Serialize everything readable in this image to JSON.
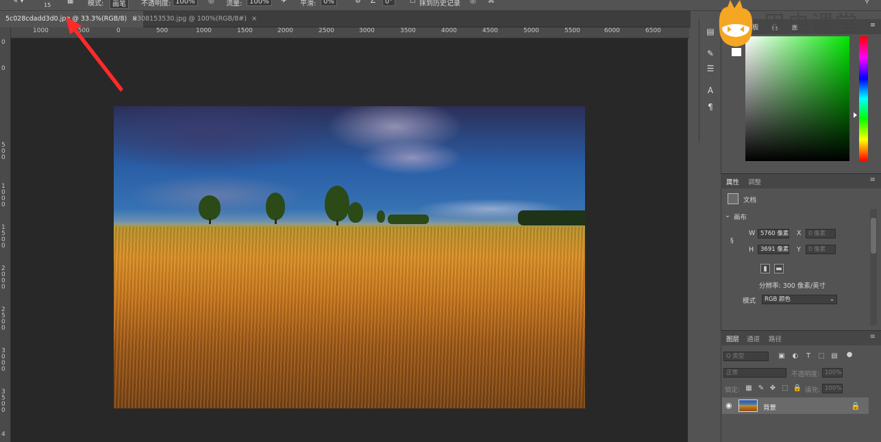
{
  "options_bar": {
    "size_value": "15",
    "mode_label": "模式:",
    "mode_value": "画笔",
    "opacity_label": "不透明度:",
    "opacity_value": "100%",
    "flow_label": "流量:",
    "flow_value": "100%",
    "smooth_label": "平滑:",
    "smooth_value": "0%",
    "angle_value": "0°",
    "history_label": "抹到历史记录"
  },
  "tabs": [
    {
      "label": "5c028cdadd3d0.jpg @ 33.3%(RGB/8)",
      "close": "×"
    },
    {
      "label": "0308153530.jpg @ 100%(RGB/8#)",
      "close": "×"
    }
  ],
  "ruler_h": [
    "1000",
    "1500",
    "0",
    "500",
    "1000",
    "1500",
    "2000",
    "2500",
    "3000",
    "3500",
    "4000",
    "4500",
    "5000",
    "5500",
    "6000",
    "6500"
  ],
  "ruler_v": [
    "0",
    "0",
    "5\n0\n0",
    "1\n0\n0\n0",
    "1\n5\n0\n0",
    "2\n0\n0\n0",
    "2\n5\n0\n0",
    "3\n0\n0\n0",
    "3\n5\n0\n0",
    "4"
  ],
  "watermark": {
    "text": "甲虫课堂"
  },
  "color_panel": {
    "tab1": "板",
    "tab2": "色",
    "tab3": "图"
  },
  "properties": {
    "tab_properties": "属性",
    "tab_adjust": "调整",
    "doc_label": "文档",
    "canvas_label": "画布",
    "w_label": "W",
    "w_value": "5760 像素",
    "h_label": "H",
    "h_value": "3691 像素",
    "x_label": "X",
    "x_placeholder": "0 像素",
    "y_label": "Y",
    "y_placeholder": "0 像素",
    "resolution": "分辨率: 300 像素/英寸",
    "mode_label": "模式",
    "mode_value": "RGB 颜色"
  },
  "layers": {
    "tab_layers": "图层",
    "tab_channels": "通道",
    "tab_paths": "路径",
    "filter_kind": "Q 类型",
    "blend_mode": "正常",
    "opacity_label": "不透明度:",
    "opacity_value": "100%",
    "lock_label": "锁定:",
    "fill_label": "填充:",
    "fill_value": "100%",
    "layer_name": "背景"
  },
  "colors": {
    "canvas": "#282828",
    "panel": "#535353",
    "arrow": "#ff2a2a"
  }
}
